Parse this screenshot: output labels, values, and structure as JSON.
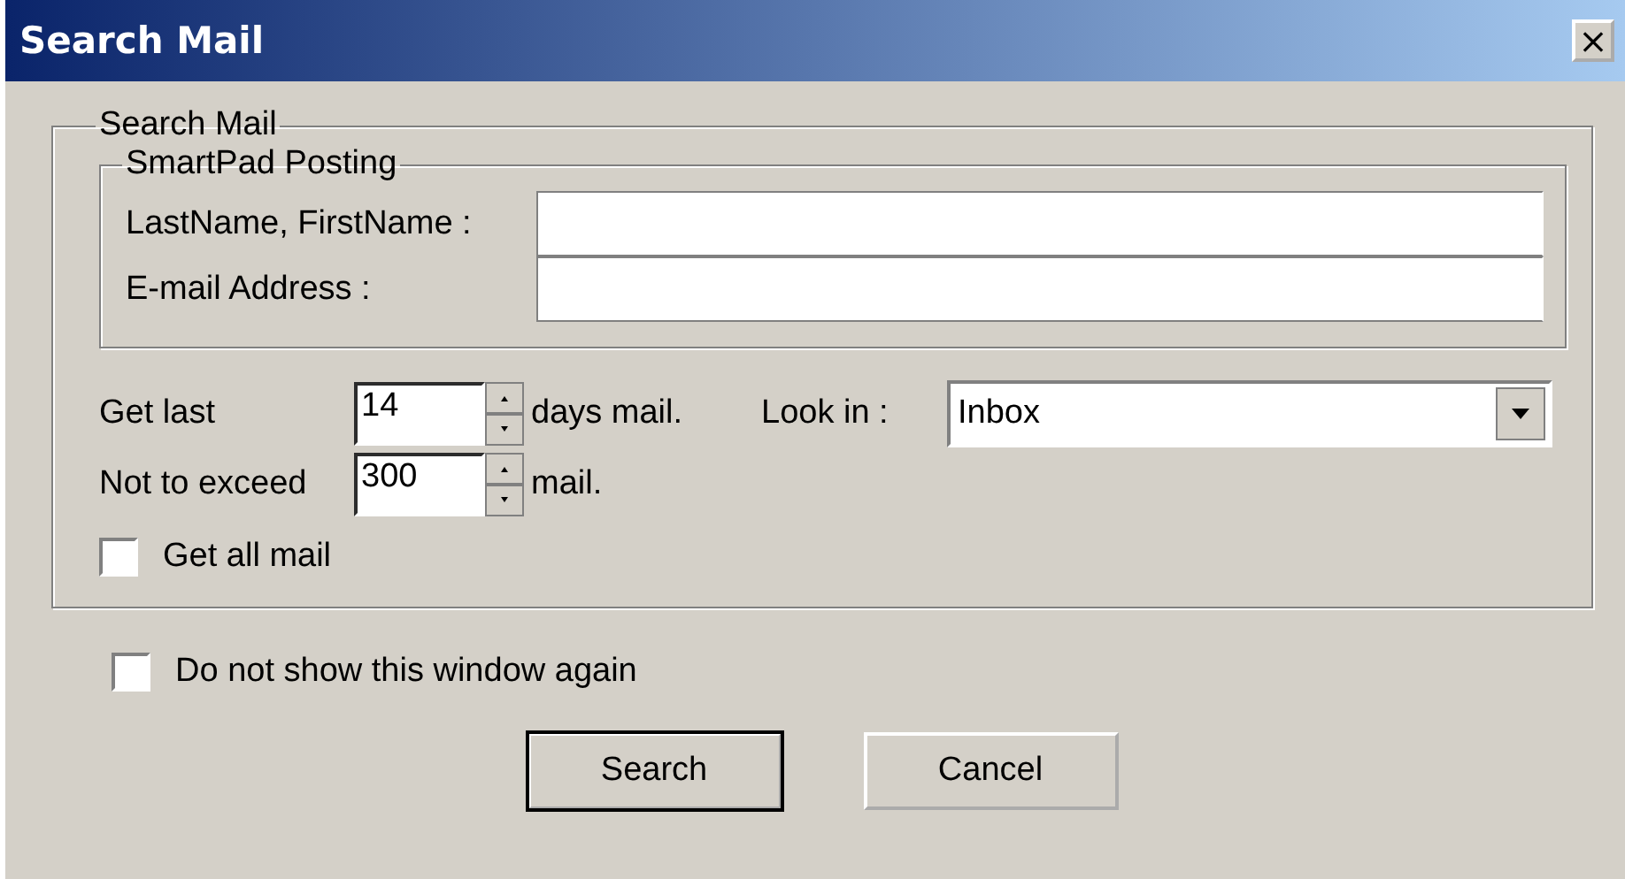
{
  "window": {
    "title": "Search Mail",
    "close": "×"
  },
  "group": {
    "title": "Search Mail"
  },
  "subgroup": {
    "title": "SmartPad Posting",
    "fields": [
      {
        "label": "LastName, FirstName :"
      },
      {
        "label": "E-mail Address :"
      }
    ]
  },
  "spinners": [
    {
      "label": "Get last",
      "value": "14",
      "suffix": "days mail."
    },
    {
      "label": "Not to exceed",
      "value": "300",
      "suffix": "mail."
    }
  ],
  "look_in": {
    "label": "Look in :",
    "value": "Inbox"
  },
  "get_all": {
    "label": "Get all mail",
    "checked": false
  },
  "dont_show": {
    "label": "Do not show this window again",
    "checked": false
  },
  "buttons": [
    {
      "label": "Search",
      "default": true
    },
    {
      "label": "Cancel",
      "default": false
    }
  ]
}
